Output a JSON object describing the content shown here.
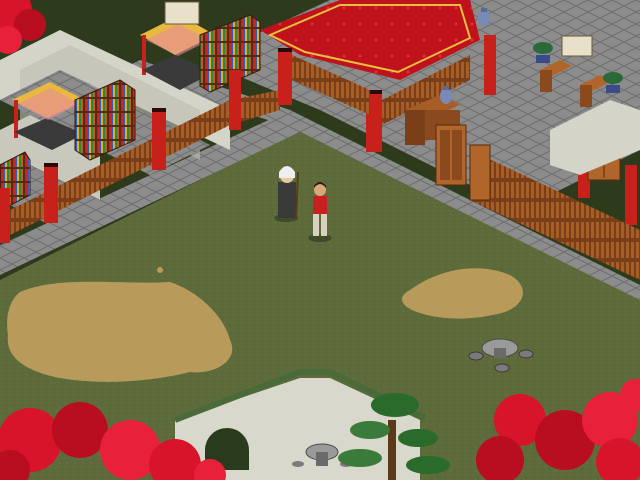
{
  "game": {
    "scene": "courtyard-compound",
    "characters": [
      {
        "role": "elder",
        "icon": "white-haired-elder-with-staff"
      },
      {
        "role": "player",
        "icon": "red-clad-young-hero"
      }
    ],
    "objects": [
      "canopy-bed",
      "bookshelf",
      "red-carpet-hall",
      "porcelain-vase",
      "stone-table",
      "stone-stool",
      "wooden-cabinet",
      "red-pillar",
      "red-maple-tree",
      "bonsai-pine",
      "moon-gate"
    ]
  },
  "palette": {
    "grass": "#5b6a3a",
    "path": "#8a8a8a",
    "pillar": "#c8201a",
    "carpet": "#c0121a",
    "wood": "#7a3e18",
    "wall": "#cfcfc4",
    "maple": "#d8142a",
    "dirt": "#b89a5a"
  }
}
